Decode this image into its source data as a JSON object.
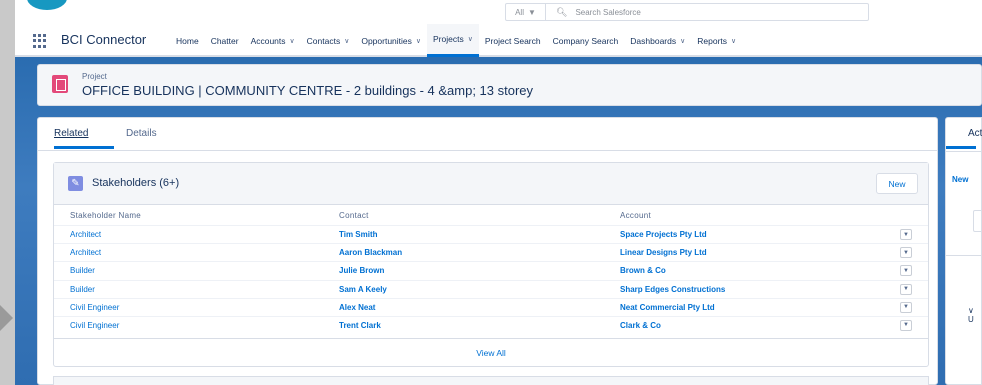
{
  "header": {
    "search_scope": "All",
    "search_placeholder": "Search Salesforce"
  },
  "nav": {
    "app_name": "BCI Connector",
    "items": [
      {
        "label": "Home",
        "has_menu": false,
        "active": false
      },
      {
        "label": "Chatter",
        "has_menu": false,
        "active": false
      },
      {
        "label": "Accounts",
        "has_menu": true,
        "active": false
      },
      {
        "label": "Contacts",
        "has_menu": true,
        "active": false
      },
      {
        "label": "Opportunities",
        "has_menu": true,
        "active": false
      },
      {
        "label": "Projects",
        "has_menu": true,
        "active": true
      },
      {
        "label": "Project Search",
        "has_menu": false,
        "active": false
      },
      {
        "label": "Company Search",
        "has_menu": false,
        "active": false
      },
      {
        "label": "Dashboards",
        "has_menu": true,
        "active": false
      },
      {
        "label": "Reports",
        "has_menu": true,
        "active": false
      }
    ]
  },
  "record": {
    "type_label": "Project",
    "title": "OFFICE BUILDING | COMMUNITY CENTRE - 2 buildings - 4 &amp; 13 storey"
  },
  "tabs": {
    "related": "Related",
    "details": "Details"
  },
  "stakeholders": {
    "title": "Stakeholders (6+)",
    "new_label": "New",
    "columns": [
      "Stakeholder Name",
      "Contact",
      "Account"
    ],
    "rows": [
      {
        "name": "Architect",
        "contact": "Tim Smith",
        "account": "Space Projects Pty Ltd"
      },
      {
        "name": "Architect",
        "contact": "Aaron Blackman",
        "account": "Linear Designs Pty Ltd"
      },
      {
        "name": "Builder",
        "contact": "Julie Brown",
        "account": "Brown & Co"
      },
      {
        "name": "Builder",
        "contact": "Sam A Keely",
        "account": "Sharp Edges Constructions"
      },
      {
        "name": "Civil Engineer",
        "contact": "Alex Neat",
        "account": "Neat Commercial Pty Ltd"
      },
      {
        "name": "Civil Engineer",
        "contact": "Trent Clark",
        "account": "Clark & Co"
      }
    ],
    "view_all": "View All"
  },
  "side_panel": {
    "tab_label": "Act",
    "new_label": "New",
    "section_label": "U"
  },
  "colors": {
    "brand_blue": "#0070d2",
    "text_dark": "#16325c",
    "project_icon": "#e3497a",
    "stakeholder_icon": "#7f8de1"
  }
}
